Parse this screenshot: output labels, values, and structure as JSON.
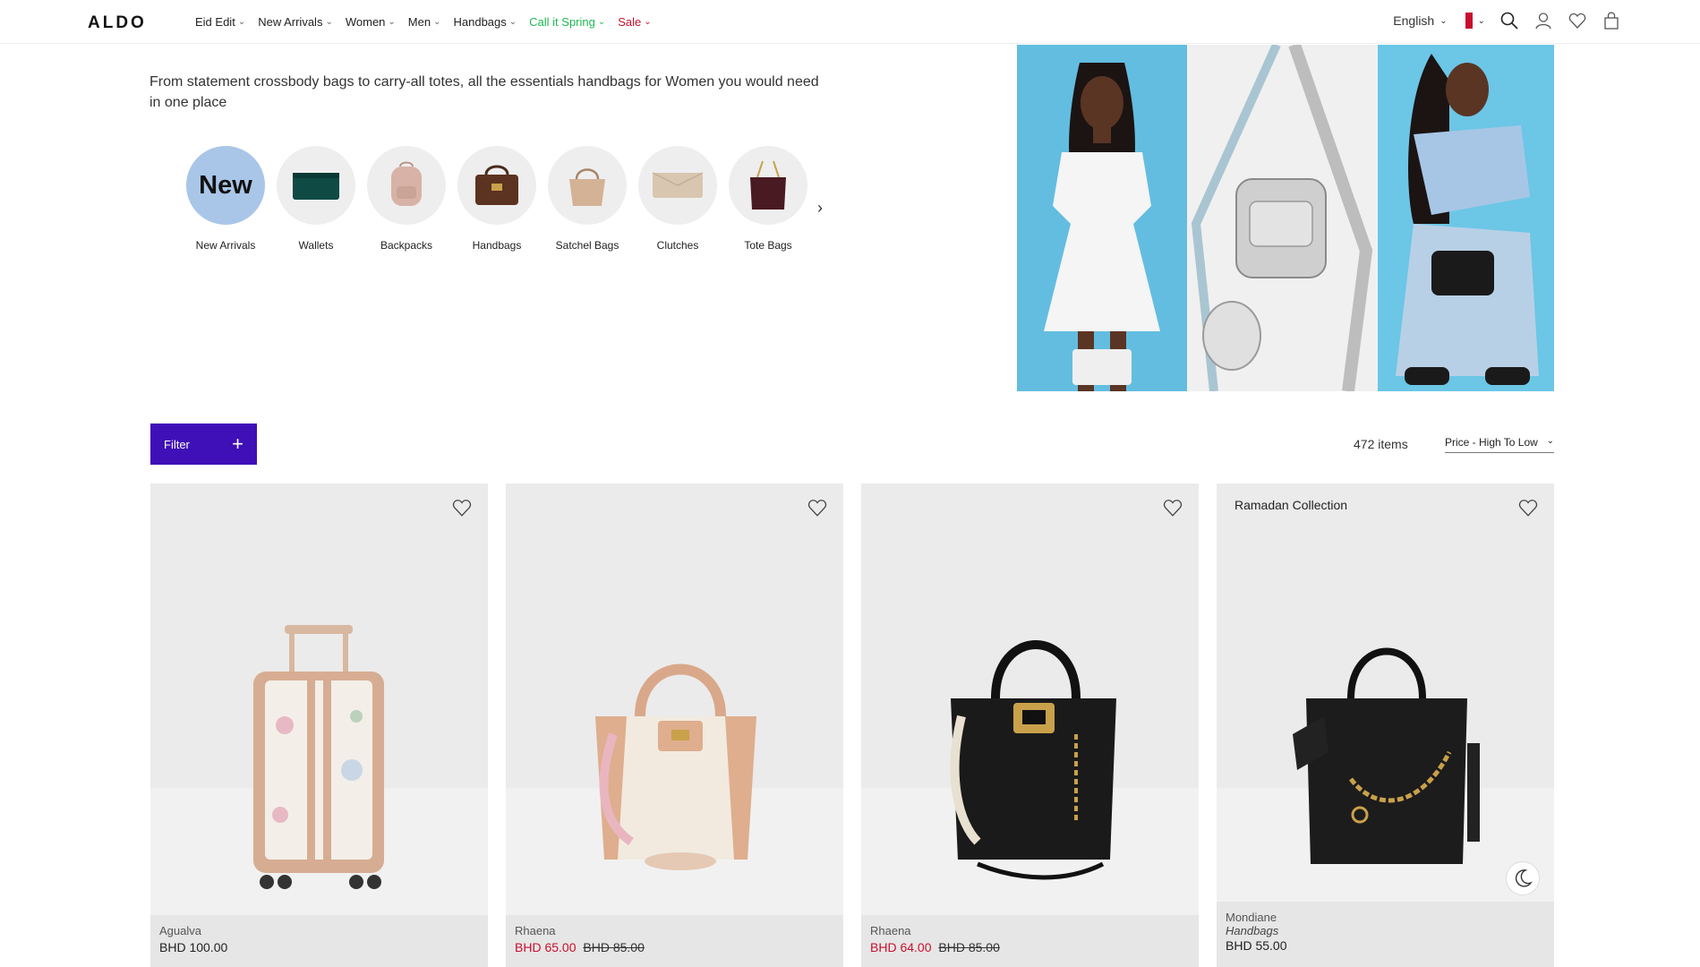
{
  "header": {
    "logo": "ALDO",
    "nav": [
      {
        "label": "Eid Edit",
        "color": "#222222"
      },
      {
        "label": "New Arrivals",
        "color": "#222222"
      },
      {
        "label": "Women",
        "color": "#222222"
      },
      {
        "label": "Men",
        "color": "#222222"
      },
      {
        "label": "Handbags",
        "color": "#222222"
      },
      {
        "label": "Call it Spring",
        "color": "#1db954"
      },
      {
        "label": "Sale",
        "color": "#c8102e"
      }
    ],
    "language": "English",
    "icons": [
      "search-icon",
      "account-icon",
      "wishlist-icon",
      "bag-icon"
    ]
  },
  "intro": "From statement crossbody bags to carry-all totes, all the essentials handbags for Women you would need in one place",
  "categories": [
    {
      "label": "New Arrivals",
      "thumb": "New"
    },
    {
      "label": "Wallets",
      "thumb": ""
    },
    {
      "label": "Backpacks",
      "thumb": ""
    },
    {
      "label": "Handbags",
      "thumb": ""
    },
    {
      "label": "Satchel Bags",
      "thumb": ""
    },
    {
      "label": "Clutches",
      "thumb": ""
    },
    {
      "label": "Tote Bags",
      "thumb": ""
    }
  ],
  "toolbar": {
    "filter_label": "Filter",
    "item_count": "472 items",
    "sort_label": "Price - High To Low"
  },
  "products": [
    {
      "badge": "",
      "name": "Agualva",
      "category": "",
      "price": "BHD 100.00",
      "old_price": "",
      "on_sale": false
    },
    {
      "badge": "",
      "name": "Rhaena",
      "category": "",
      "price": "BHD 65.00",
      "old_price": "BHD 85.00",
      "on_sale": true
    },
    {
      "badge": "",
      "name": "Rhaena",
      "category": "",
      "price": "BHD 64.00",
      "old_price": "BHD 85.00",
      "on_sale": true
    },
    {
      "badge": "Ramadan Collection",
      "name": "Mondiane",
      "category": "Handbags",
      "price": "BHD 55.00",
      "old_price": "",
      "on_sale": false
    }
  ],
  "colors": {
    "accent": "#3f0fb7",
    "sale": "#c8102e",
    "spring": "#1db954"
  }
}
